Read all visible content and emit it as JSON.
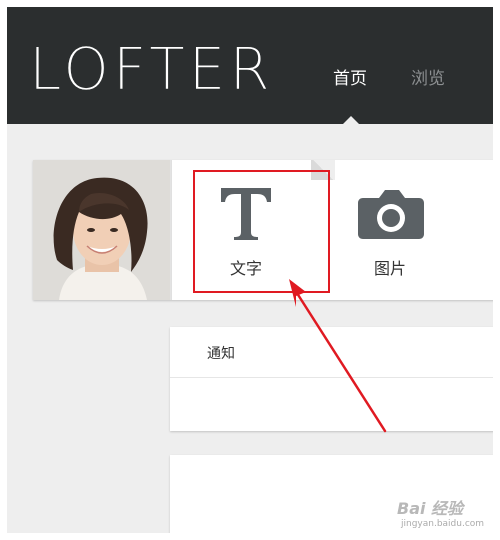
{
  "header": {
    "logo_text": "LOFTER",
    "nav": [
      {
        "label": "首页",
        "active": true
      },
      {
        "label": "浏览",
        "active": false
      }
    ],
    "background": "#2b2e2f"
  },
  "composer": {
    "post_types": [
      {
        "label": "文字",
        "icon": "text-t-icon"
      },
      {
        "label": "图片",
        "icon": "camera-icon"
      }
    ]
  },
  "notifications": {
    "title": "通知"
  },
  "watermark": {
    "brand": "Bai 经验",
    "url": "jingyan.baidu.com"
  },
  "annotation_color": "#e01a22"
}
